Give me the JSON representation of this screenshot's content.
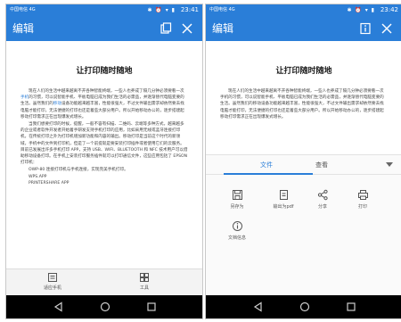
{
  "left_screen": {
    "status": {
      "carrier": "中国电信 4G",
      "icons": "✱ ⏰ ▾ ▮",
      "time": "23:41"
    },
    "appbar": {
      "title": "编辑",
      "copy_icon": "copy-icon",
      "close_icon": "close-icon"
    },
    "document": {
      "title": "让打印随时随地",
      "para1_pre": "现在人们的生活中越来越离不开各种智能终端，一些人也养成了隔几分钟必须要看一次",
      "para1_link": "手机",
      "para1_mid": "的习惯，可以说智能手机、平板电脑已成为我们生活的必需品，并逐渐替代电脑变要的生活。虽然我们的",
      "para1_link2": "移动",
      "para1_post": "设备功能越来越丰富，性能很强大，不过文件输出需求却依然要去找电脑才能打印，无法便捷的打印也还是着些大部分用户。所以开始移动办公的，逐步搭建起移动打印需求正在出现爆发式增长。",
      "para2": "当我们想要打印的时候，提醒，一般不容有扫描、二维码、云端等多种方式，越来越多的企业或者软件开发者开始着手研发支持手机打印的应用，比如采用无线或蓝牙连接打印机，在传统打印之外为打印机增加新功能和内容的输出。移动打印是当前这个时代的新领域，手机中的文件到打印机，但是了一个前提就是要安装打印插件或者使用它们的云服务。目前已发展出许多手机打印 APP，支持 USB、WIFI、BLUETOOTH 和 NFC 技术用户可以借助移动设备打印。在手机上安装打印服务插件就可以打印通信文件，这些应用包括了 EPSON 打印机：",
      "line1": "OWP-80 连接打印机与手机连接，实现完美手机打印。",
      "line2": "WPS.APP",
      "line3": "PRINTERSHARE APP"
    },
    "bottom_tools": {
      "left_label": "适应手机",
      "right_label": "工具"
    }
  },
  "right_screen": {
    "status": {
      "carrier": "中国电信 4G",
      "icons": "✱ ⏰ ▾ ▮",
      "time": "23:42"
    },
    "appbar": {
      "title": "编辑",
      "info_icon": "info-icon",
      "close_icon": "close-icon"
    },
    "document": {
      "title": "让打印随时随地",
      "para1": "现在人们的生活中越来越离不开各种智能终端，一些人也养成了隔几分钟必须要看一次手机的习惯，可以说智能手机、平板电脑已成为我们生活的必需品，并逐渐替代电脑变要的生活。虽然我们的移动设备功能越来越丰富，性能很强大，不过文件输出需求却依然要去找电脑才能打印，无法便捷的打印也还是着些大部分用户。所以开始移动办公的，逐步搭建起移动打印需求正在出现爆发式增长。"
    },
    "sheet": {
      "tabs": [
        "文件",
        "查看"
      ],
      "actions": [
        {
          "icon": "save-as-icon",
          "label": "另存为"
        },
        {
          "icon": "pdf-icon",
          "label": "输出为pdf"
        },
        {
          "icon": "share-icon",
          "label": "分享"
        },
        {
          "icon": "print-icon",
          "label": "打印"
        },
        {
          "icon": "info-icon",
          "label": "文档信息"
        }
      ]
    }
  },
  "colors": {
    "primary": "#2a7ed8",
    "navbar": "#000000",
    "sheet_bg": "#fafafa"
  }
}
